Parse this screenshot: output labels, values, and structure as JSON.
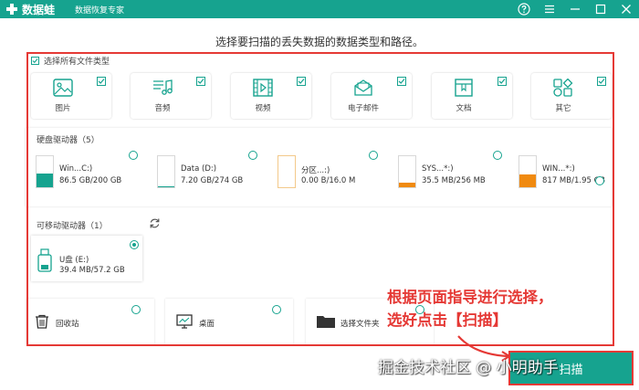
{
  "app": {
    "name": "数据蛙",
    "subtitle": "数据恢复专家"
  },
  "instruction": "选择要扫描的丢失数据的数据类型和路径。",
  "select_all_label": "选择所有文件类型",
  "file_types": [
    {
      "label": "图片",
      "icon": "image-icon",
      "checked": true
    },
    {
      "label": "音频",
      "icon": "audio-icon",
      "checked": true
    },
    {
      "label": "视频",
      "icon": "video-icon",
      "checked": true
    },
    {
      "label": "电子邮件",
      "icon": "email-icon",
      "checked": true
    },
    {
      "label": "文档",
      "icon": "document-icon",
      "checked": true
    },
    {
      "label": "其它",
      "icon": "other-icon",
      "checked": true
    }
  ],
  "hard_drives": {
    "title": "硬盘驱动器（5）",
    "items": [
      {
        "name": "Win...C:)",
        "size": "86.5 GB/200 GB",
        "used_fraction": 0.43,
        "fill_color": "#16a38f"
      },
      {
        "name": "Data (D:)",
        "size": "7.20 GB/274 GB",
        "used_fraction": 0.03,
        "fill_color": "#16a38f"
      },
      {
        "name": "分区...:)",
        "size": "0.00  B/16.0 M",
        "used_fraction": 0.0,
        "fill_color": "#f0a030"
      },
      {
        "name": "SYS...*:)",
        "size": "35.5 MB/256 MB",
        "used_fraction": 0.14,
        "fill_color": "#f08a10"
      },
      {
        "name": "WIN...*:)",
        "size": "817 MB/1.95 GB",
        "used_fraction": 0.42,
        "fill_color": "#f08a10"
      }
    ]
  },
  "removable": {
    "title": "可移动驱动器（1）",
    "items": [
      {
        "name": "U盘 (E:)",
        "size": "39.4 MB/57.2 GB",
        "selected": true
      }
    ]
  },
  "locations": [
    {
      "label": "回收站",
      "icon": "recycle-bin-icon"
    },
    {
      "label": "桌面",
      "icon": "desktop-icon"
    },
    {
      "label": "选择文件夹",
      "icon": "folder-icon"
    }
  ],
  "annotation": {
    "line1": "根据页面指导进行选择，",
    "line2": "选好点击【扫描】"
  },
  "scan_button": "扫描",
  "watermark": "掘金技术社区 @ 小明助手",
  "colors": {
    "accent": "#16a38f",
    "annotation": "#e53935"
  }
}
